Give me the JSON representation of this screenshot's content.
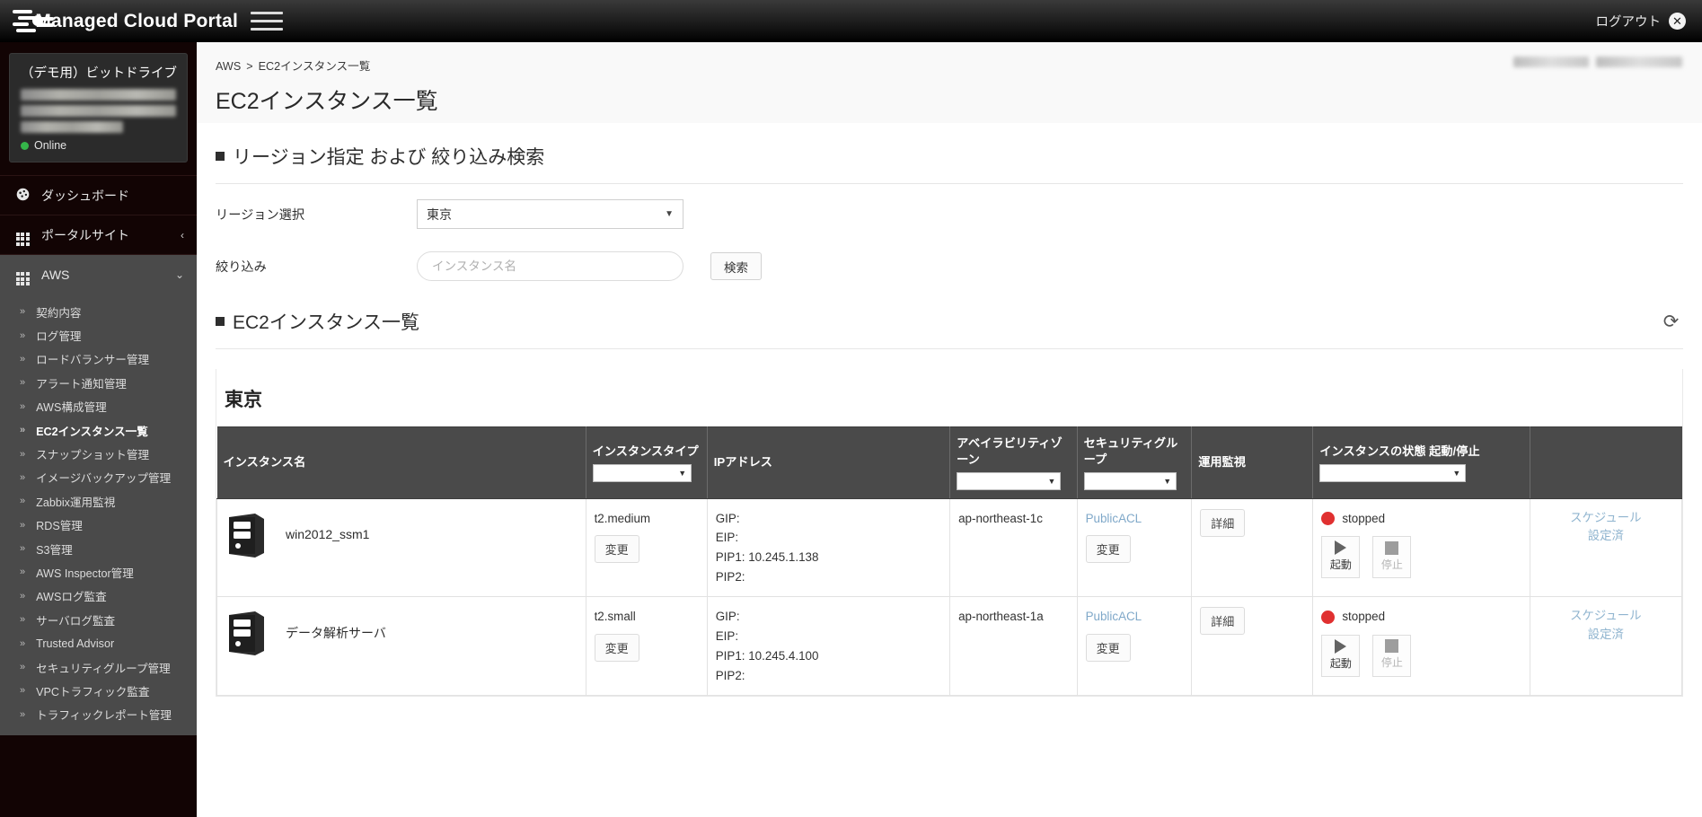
{
  "topbar": {
    "brand_title": "Managed Cloud Portal",
    "menu_icon": "hamburger-icon",
    "logout_label": "ログアウト",
    "logout_icon": "close-circle-icon"
  },
  "sidebar": {
    "account_name": "（デモ用）ビットドライブ",
    "status_label": "Online",
    "main_items": [
      {
        "label": "ダッシュボード",
        "icon": "dashboard-icon",
        "active": false
      },
      {
        "label": "ポータルサイト",
        "icon": "grid-icon",
        "active": false,
        "chevron": "‹"
      },
      {
        "label": "AWS",
        "icon": "grid-icon",
        "active": true,
        "chevron": "⌄"
      }
    ],
    "sub_items": [
      {
        "label": "契約内容"
      },
      {
        "label": "ログ管理"
      },
      {
        "label": "ロードバランサー管理"
      },
      {
        "label": "アラート通知管理"
      },
      {
        "label": "AWS構成管理"
      },
      {
        "label": "EC2インスタンス一覧",
        "current": true
      },
      {
        "label": "スナップショット管理"
      },
      {
        "label": "イメージバックアップ管理"
      },
      {
        "label": "Zabbix運用監視"
      },
      {
        "label": "RDS管理"
      },
      {
        "label": "S3管理"
      },
      {
        "label": "AWS Inspector管理"
      },
      {
        "label": "AWSログ監査"
      },
      {
        "label": "サーバログ監査"
      },
      {
        "label": "Trusted Advisor"
      },
      {
        "label": "セキュリティグループ管理"
      },
      {
        "label": "VPCトラフィック監査"
      },
      {
        "label": "トラフィックレポート管理"
      }
    ]
  },
  "breadcrumb": {
    "root": "AWS",
    "separator": ">",
    "current": "EC2インスタンス一覧"
  },
  "page_title": "EC2インスタンス一覧",
  "filter_section": {
    "heading": "リージョン指定 および 絞り込み検索",
    "region_label": "リージョン選択",
    "region_value": "東京",
    "region_caret": "▼",
    "filter_label": "絞り込み",
    "filter_value": "",
    "filter_placeholder": "インスタンス名",
    "search_button": "検索"
  },
  "list_section": {
    "heading": "EC2インスタンス一覧",
    "refresh_icon": "refresh-icon",
    "region_title": "東京",
    "columns": [
      {
        "label": "インスタンス名",
        "has_filter": false
      },
      {
        "label": "インスタンスタイプ",
        "has_filter": true
      },
      {
        "label": "IPアドレス",
        "has_filter": false
      },
      {
        "label": "アベイラビリティゾーン",
        "has_filter": true
      },
      {
        "label": "セキュリティグループ",
        "has_filter": true
      },
      {
        "label": "運用監視",
        "has_filter": false
      },
      {
        "label": "インスタンスの状態 起動/停止",
        "has_filter": true
      },
      {
        "label": "",
        "has_filter": false
      }
    ],
    "rows": [
      {
        "icon": "server-icon",
        "name": "win2012_ssm1",
        "instance_type": "t2.medium",
        "type_change_button": "変更",
        "ip_gip": "GIP:",
        "ip_eip": "EIP:",
        "ip_pip1": "PIP1: 10.245.1.138",
        "ip_pip2": "PIP2:",
        "availability_zone": "ap-northeast-1c",
        "security_group": "PublicACL",
        "sg_change_button": "変更",
        "monitor_button": "詳細",
        "state": "stopped",
        "start_button": "起動",
        "stop_button": "停止",
        "schedule_line1": "スケジュール",
        "schedule_line2": "設定済"
      },
      {
        "icon": "server-icon",
        "name": "データ解析サーバ",
        "instance_type": "t2.small",
        "type_change_button": "変更",
        "ip_gip": "GIP:",
        "ip_eip": "EIP:",
        "ip_pip1": "PIP1: 10.245.4.100",
        "ip_pip2": "PIP2:",
        "availability_zone": "ap-northeast-1a",
        "security_group": "PublicACL",
        "sg_change_button": "変更",
        "monitor_button": "詳細",
        "state": "stopped",
        "start_button": "起動",
        "stop_button": "停止",
        "schedule_line1": "スケジュール",
        "schedule_line2": "設定済"
      }
    ]
  },
  "colors": {
    "topbar_dark": "#000000",
    "sidebar_dark": "#120404",
    "sidebar_active": "#4a4a4a",
    "table_header": "#4a4a4a",
    "status_stopped": "#e03030",
    "status_online": "#35b44a",
    "link_blue": "#7fa8c9"
  }
}
